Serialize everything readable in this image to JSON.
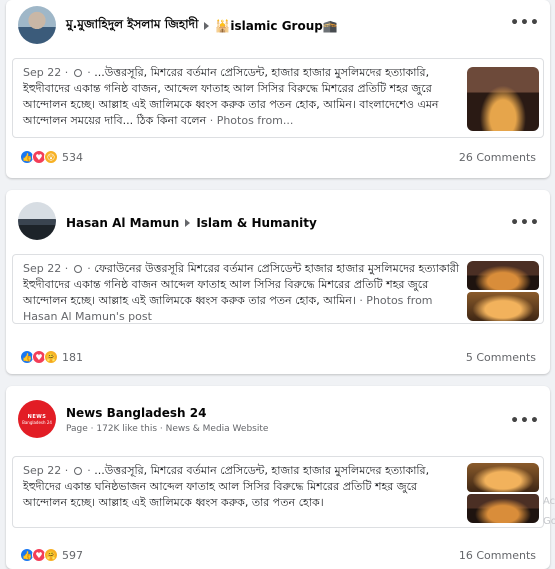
{
  "posts": [
    {
      "author": "মু.মুজাহিদুল ইসলাম জিহাদী",
      "group": "🕌islamic Group🕋",
      "date": "Sep 22",
      "dot": "·",
      "text": "...উত্তরসূরি, মিশরের বর্তমান প্রেসিডেন্ট, হাজার হাজার মুসলিমদের হত্যাকারি, ইহুদীবাদের একান্ত গনিষ্ঠ বাজন, আব্দেল ফাতাহ আল সিসির বিরুদ্ধে মিশরের প্রতিটি শহর জুরে আন্দোলন হচ্ছে। আল্লাহ এই জালিমকে ধ্বংস করুক তার পতন হোক, আমিন। বাংলাদেশেও এমন আন্দোলন সময়ের দাবি... ঠিক কিনা বলেন",
      "suffix": "· Photos from...",
      "reaction_count": "534",
      "comments": "26 Comments"
    },
    {
      "author": "Hasan Al Mamun",
      "group": "Islam & Humanity",
      "date": "Sep 22",
      "dot": "·",
      "text": "ফেরাউনের উত্তরসূরি মিশরের বর্তমান প্রেসিডেন্ট হাজার হাজার মুসলিমদের হত্যাকারী ইহুদীবাদের একান্ত গনিষ্ঠ বাজন আব্দেল ফাতাহ আল সিসির বিরুদ্ধে মিশরের প্রতিটি শহর জুরে আন্দোলন হচ্ছে। আল্লাহ এই জালিমকে ধ্বংস করুক তার পতন হোক, আমিন।",
      "suffix": "· Photos from Hasan Al Mamun's post",
      "reaction_count": "181",
      "comments": "5 Comments"
    },
    {
      "author": "News Bangladesh 24",
      "avatar_line1": "NEWS",
      "avatar_line2": "Bangladesh 24",
      "subline": "Page · 172K like this · News & Media Website",
      "date": "Sep 22",
      "dot": "·",
      "text": "...উত্তরসূরি, মিশরের বর্তমান প্রেসিডেন্ট, হাজার হাজার মুসলিমদের হত্যাকারি, ইহুদীদের একান্ত ঘনিষ্ঠভাজন আব্দেল ফাতাহ আল সিসির বিরুদ্ধে মিশরের প্রতিটি শহর জুরে আন্দোলন হচ্ছে। আল্লাহ এই জালিমকে ধ্বংস করুক, তার পতন হোক।",
      "reaction_count": "597",
      "comments": "16 Comments"
    }
  ],
  "more_label": "•••",
  "side_text": "Ac Go",
  "colors": {
    "like": "#1877f2",
    "love": "#f33e58",
    "wow": "#f7b125"
  }
}
